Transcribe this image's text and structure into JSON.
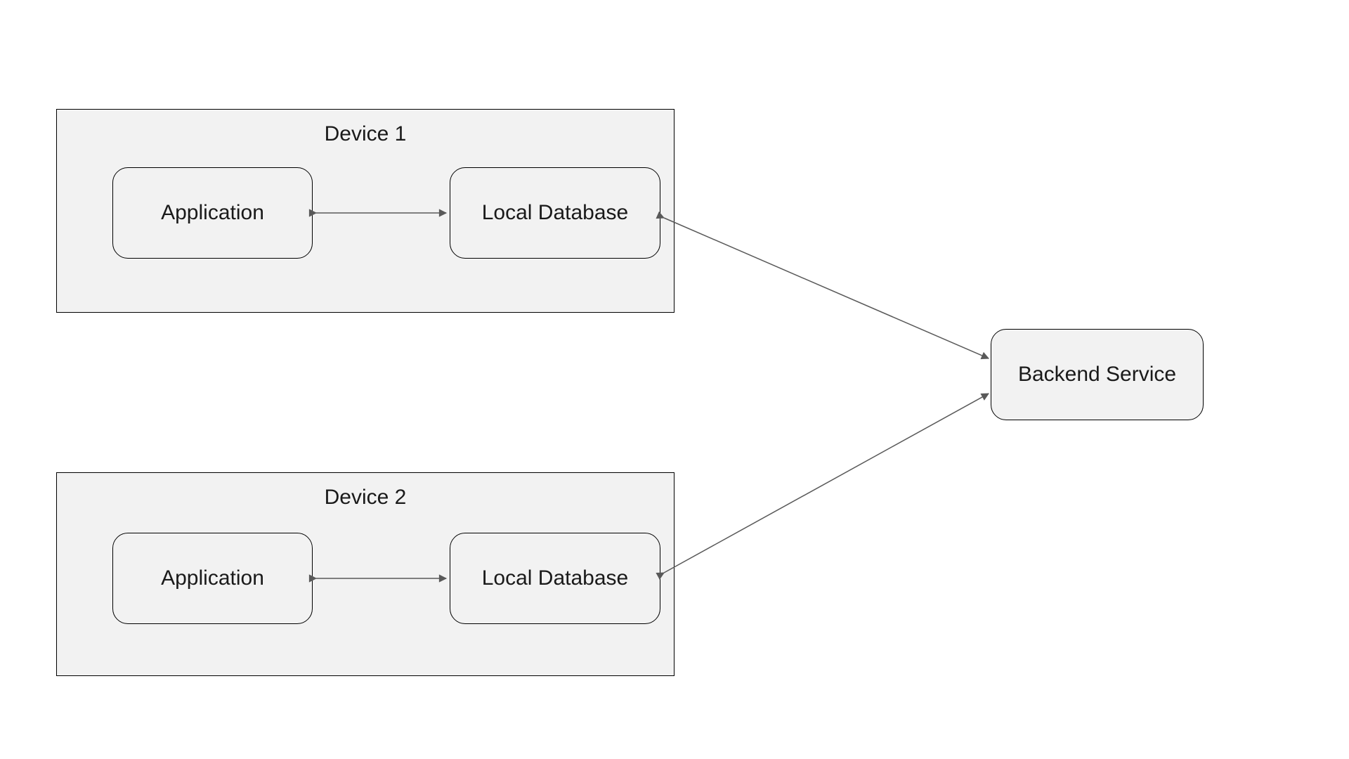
{
  "devices": [
    {
      "title": "Device 1",
      "application_label": "Application",
      "local_db_label": "Local Database"
    },
    {
      "title": "Device 2",
      "application_label": "Application",
      "local_db_label": "Local Database"
    }
  ],
  "backend_label": "Backend Service"
}
